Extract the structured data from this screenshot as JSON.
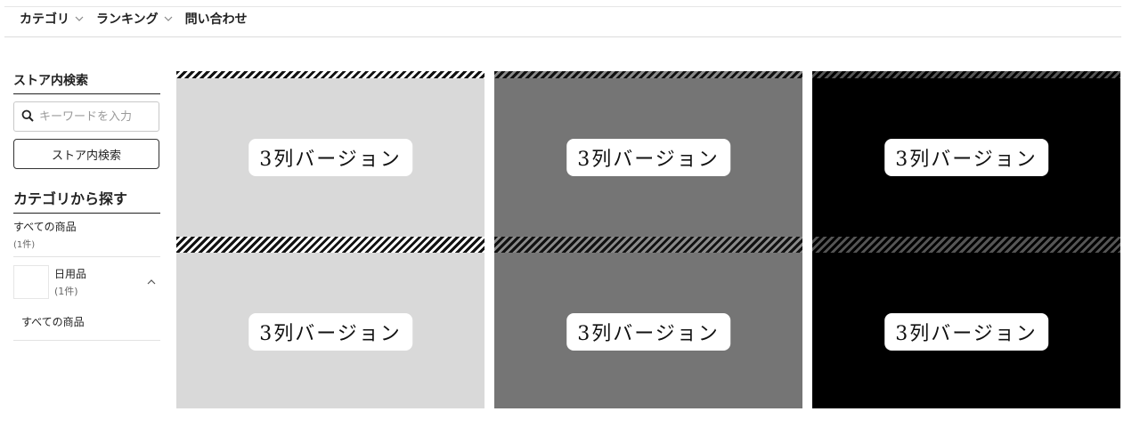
{
  "nav": {
    "items": [
      {
        "label": "カテゴリ",
        "has_dropdown": true
      },
      {
        "label": "ランキング",
        "has_dropdown": true
      },
      {
        "label": "問い合わせ",
        "has_dropdown": false
      }
    ]
  },
  "sidebar": {
    "search_heading": "ストア内検索",
    "search_placeholder": "キーワードを入力",
    "search_button": "ストア内検索",
    "category_heading": "カテゴリから探す",
    "all_items": {
      "label": "すべての商品",
      "count": "(1件)"
    },
    "category": {
      "label": "日用品",
      "count": "(1件)",
      "expanded": true
    },
    "subcategory": "すべての商品"
  },
  "banners": [
    {
      "label": "3列バージョン",
      "tone": "light"
    },
    {
      "label": "3列バージョン",
      "tone": "mid"
    },
    {
      "label": "3列バージョン",
      "tone": "dark"
    },
    {
      "label": "3列バージョン",
      "tone": "light"
    },
    {
      "label": "3列バージョン",
      "tone": "mid"
    },
    {
      "label": "3列バージョン",
      "tone": "dark"
    }
  ],
  "colors": {
    "banner_light": "#d9d9d9",
    "banner_mid": "#757575",
    "banner_dark": "#000000",
    "text": "#222222"
  },
  "icons": {
    "search": "search-icon",
    "dropdown": "chevron-down-icon",
    "collapse": "chevron-up-icon"
  }
}
